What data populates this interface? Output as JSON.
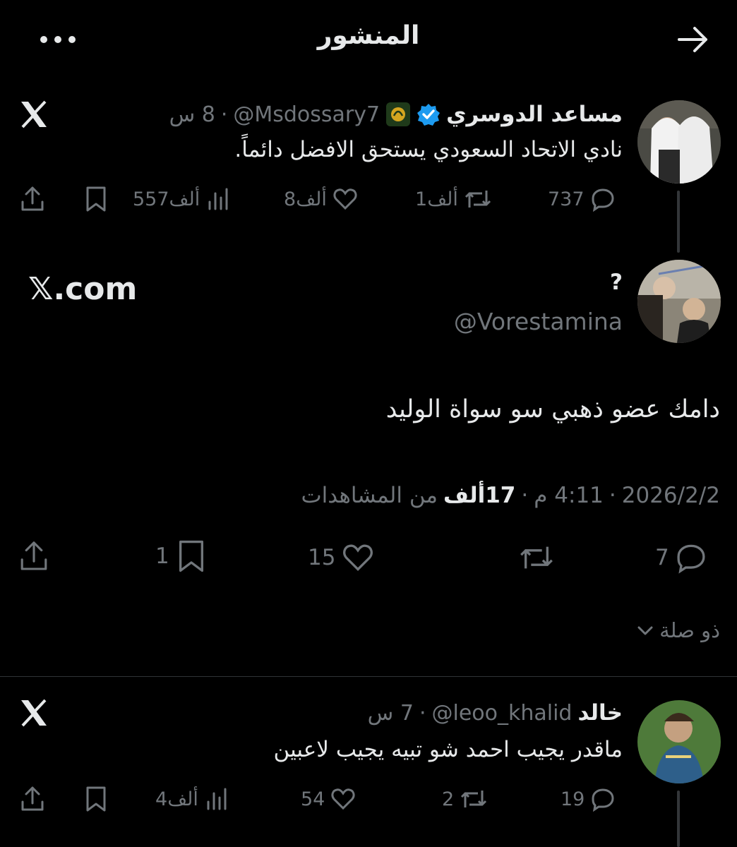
{
  "header": {
    "title": "المنشور"
  },
  "quoted_post": {
    "name": "مساعد الدوسري",
    "handle": "@Msdossary7",
    "time": "8 س",
    "text": "نادي الاتحاد السعودي يستحق الافضل دائماً.",
    "replies": "737",
    "reposts": "1ألف",
    "likes": "8ألف",
    "views": "557ألف"
  },
  "main_post": {
    "name": "?",
    "handle": "@Vorestamina",
    "watermark": "𝕏.com",
    "text": "دامك عضو ذهبي سو سواة الوليد",
    "date": "2026/2/2",
    "time": "4:11 م",
    "views_count": "17ألف",
    "views_label": "من المشاهدات",
    "replies": "7",
    "likes": "15",
    "bookmarks": "1"
  },
  "related": {
    "label": "ذو صلة"
  },
  "reply_post": {
    "name": "خالد",
    "handle": "@leoo_khalid",
    "time": "7 س",
    "text": "ماقدر يجيب احمد شو تبيه يجيب لاعبين",
    "replies": "19",
    "reposts": "2",
    "likes": "54",
    "views": "4ألف"
  },
  "colors": {
    "background": "#000000",
    "text": "#e7e9ea",
    "muted": "#71767b",
    "verified": "#1d9bf0",
    "divider": "#2f3336"
  },
  "icons": [
    "arrow-right-icon",
    "more-icon",
    "x-logo-icon",
    "verified-badge-icon",
    "reply-icon",
    "repost-icon",
    "like-icon",
    "bookmark-icon",
    "views-icon",
    "share-icon",
    "chevron-down-icon"
  ]
}
